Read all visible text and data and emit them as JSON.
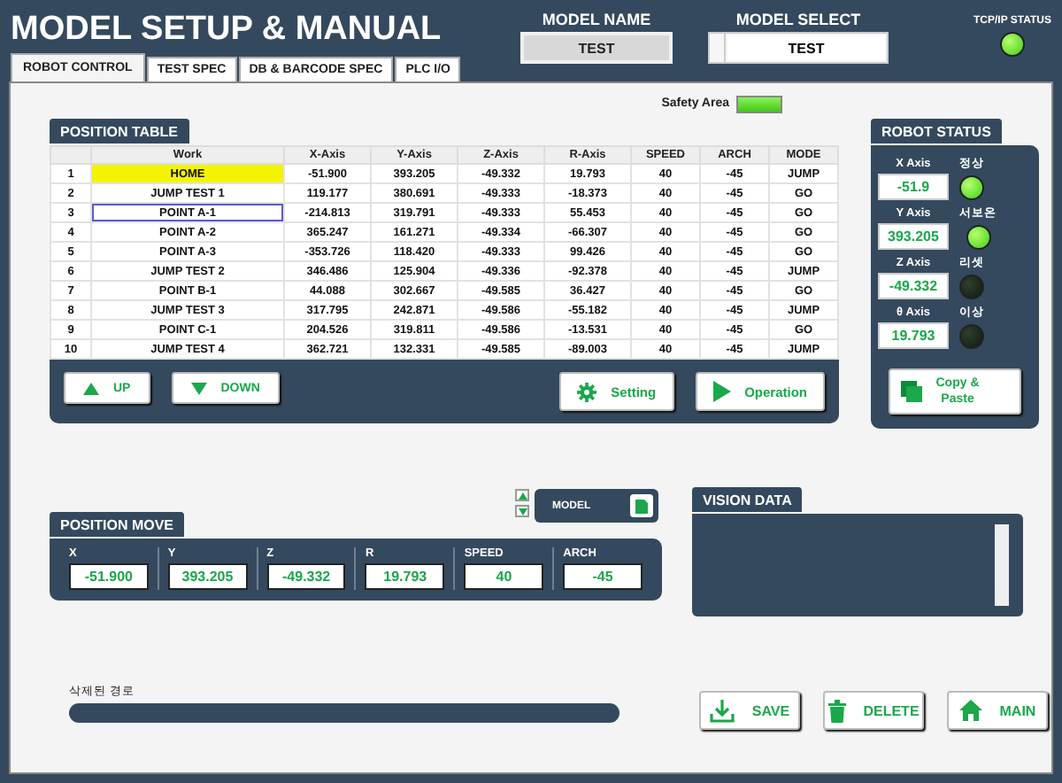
{
  "header": {
    "title": "MODEL SETUP & MANUAL",
    "model_name": {
      "label": "MODEL NAME",
      "value": "TEST"
    },
    "model_select": {
      "label": "MODEL SELECT",
      "value": "TEST"
    },
    "tcp_status": {
      "label": "TCP/IP STATUS",
      "on": true
    }
  },
  "tabs": [
    {
      "label": "ROBOT CONTROL",
      "selected": true
    },
    {
      "label": "TEST SPEC",
      "selected": false
    },
    {
      "label": "DB & BARCODE SPEC",
      "selected": false
    },
    {
      "label": "PLC I/O",
      "selected": false
    }
  ],
  "safety_area": {
    "label": "Safety Area",
    "on": true
  },
  "position_table": {
    "title": "POSITION TABLE",
    "columns": [
      "Work",
      "X-Axis",
      "Y-Axis",
      "Z-Axis",
      "R-Axis",
      "SPEED",
      "ARCH",
      "MODE"
    ],
    "rows": [
      {
        "index": "1",
        "cells": [
          "HOME",
          "-51.900",
          "393.205",
          "-49.332",
          "19.793",
          "40",
          "-45",
          "JUMP"
        ],
        "selected": true,
        "focused": false
      },
      {
        "index": "2",
        "cells": [
          "JUMP TEST 1",
          "119.177",
          "380.691",
          "-49.333",
          "-18.373",
          "40",
          "-45",
          "GO"
        ],
        "selected": false,
        "focused": false
      },
      {
        "index": "3",
        "cells": [
          "POINT A-1",
          "-214.813",
          "319.791",
          "-49.333",
          "55.453",
          "40",
          "-45",
          "GO"
        ],
        "selected": false,
        "focused": true
      },
      {
        "index": "4",
        "cells": [
          "POINT A-2",
          "365.247",
          "161.271",
          "-49.334",
          "-66.307",
          "40",
          "-45",
          "GO"
        ],
        "selected": false,
        "focused": false
      },
      {
        "index": "5",
        "cells": [
          "POINT A-3",
          "-353.726",
          "118.420",
          "-49.333",
          "99.426",
          "40",
          "-45",
          "GO"
        ],
        "selected": false,
        "focused": false
      },
      {
        "index": "6",
        "cells": [
          "JUMP TEST 2",
          "346.486",
          "125.904",
          "-49.336",
          "-92.378",
          "40",
          "-45",
          "JUMP"
        ],
        "selected": false,
        "focused": false
      },
      {
        "index": "7",
        "cells": [
          "POINT B-1",
          "44.088",
          "302.667",
          "-49.585",
          "36.427",
          "40",
          "-45",
          "GO"
        ],
        "selected": false,
        "focused": false
      },
      {
        "index": "8",
        "cells": [
          "JUMP TEST 3",
          "317.795",
          "242.871",
          "-49.586",
          "-55.182",
          "40",
          "-45",
          "JUMP"
        ],
        "selected": false,
        "focused": false
      },
      {
        "index": "9",
        "cells": [
          "POINT C-1",
          "204.526",
          "319.811",
          "-49.586",
          "-13.531",
          "40",
          "-45",
          "GO"
        ],
        "selected": false,
        "focused": false
      },
      {
        "index": "10",
        "cells": [
          "JUMP TEST 4",
          "362.721",
          "132.331",
          "-49.585",
          "-89.003",
          "40",
          "-45",
          "JUMP"
        ],
        "selected": false,
        "focused": false
      }
    ],
    "buttons": [
      {
        "label": "UP",
        "kind": "up"
      },
      {
        "label": "DOWN",
        "kind": "down"
      },
      {
        "label": "Setting",
        "kind": "gear"
      },
      {
        "label": "Operation",
        "kind": "play"
      }
    ]
  },
  "robot_status": {
    "title": "ROBOT STATUS",
    "axes": [
      {
        "label": "X Axis",
        "value": "-51.9"
      },
      {
        "label": "Y Axis",
        "value": "393.205"
      },
      {
        "label": "Z Axis",
        "value": "-49.332"
      },
      {
        "label": "θ Axis",
        "value": "19.793"
      }
    ],
    "lamps": [
      {
        "label": "정상",
        "on": true
      },
      {
        "label": "서보온",
        "on": true
      },
      {
        "label": "리셋",
        "on": false
      },
      {
        "label": "이상",
        "on": false
      }
    ],
    "copy_button": "Copy & Paste"
  },
  "model_control": {
    "label": "MODEL"
  },
  "position_move": {
    "title": "POSITION MOVE",
    "fields": [
      {
        "label": "X",
        "value": "-51.900"
      },
      {
        "label": "Y",
        "value": "393.205"
      },
      {
        "label": "Z",
        "value": "-49.332"
      },
      {
        "label": "R",
        "value": "19.793"
      },
      {
        "label": "SPEED",
        "value": "40"
      },
      {
        "label": "ARCH",
        "value": "-45"
      }
    ]
  },
  "vision_data": {
    "title": "VISION DATA"
  },
  "path": {
    "label": "삭제된 경로"
  },
  "actions": [
    {
      "label": "SAVE",
      "kind": "save"
    },
    {
      "label": "DELETE",
      "kind": "delete"
    },
    {
      "label": "MAIN",
      "kind": "home"
    }
  ]
}
